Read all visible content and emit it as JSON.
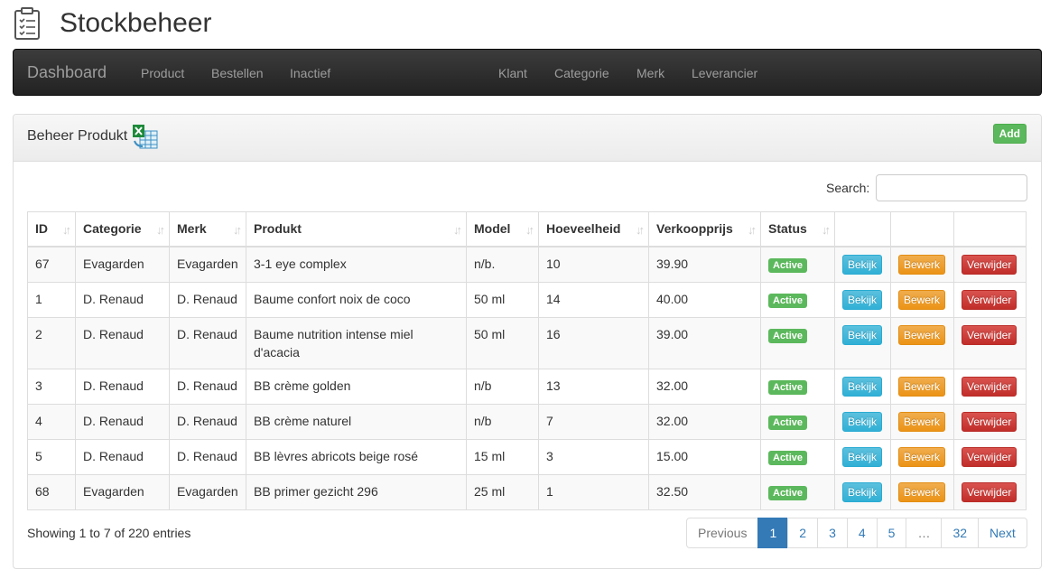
{
  "app": {
    "title": "Stockbeheer",
    "icon": "clipboard-icon"
  },
  "navbar": {
    "brand": "Dashboard",
    "links": [
      "Product",
      "Bestellen",
      "Inactief",
      "Klant",
      "Categorie",
      "Merk",
      "Leverancier"
    ]
  },
  "panel": {
    "title": "Beheer Produkt",
    "title_icon": "excel-icon",
    "add_label": "Add"
  },
  "search": {
    "label": "Search:",
    "value": ""
  },
  "table": {
    "headers": [
      "ID",
      "Categorie",
      "Merk",
      "Produkt",
      "Model",
      "Hoeveelheid",
      "Verkoopprijs",
      "Status",
      "",
      "",
      ""
    ],
    "rows": [
      {
        "id": "67",
        "categorie": "Evagarden",
        "merk": "Evagarden",
        "produkt": "3-1 eye complex",
        "model": "n/b.",
        "hoeveelheid": "10",
        "prijs": "39.90",
        "status": "Active"
      },
      {
        "id": "1",
        "categorie": "D. Renaud",
        "merk": "D. Renaud",
        "produkt": "Baume confort noix de coco",
        "model": "50 ml",
        "hoeveelheid": "14",
        "prijs": "40.00",
        "status": "Active"
      },
      {
        "id": "2",
        "categorie": "D. Renaud",
        "merk": "D. Renaud",
        "produkt": "Baume nutrition intense miel d'acacia",
        "model": "50 ml",
        "hoeveelheid": "16",
        "prijs": "39.00",
        "status": "Active"
      },
      {
        "id": "3",
        "categorie": "D. Renaud",
        "merk": "D. Renaud",
        "produkt": "BB crème golden",
        "model": "n/b",
        "hoeveelheid": "13",
        "prijs": "32.00",
        "status": "Active"
      },
      {
        "id": "4",
        "categorie": "D. Renaud",
        "merk": "D. Renaud",
        "produkt": "BB crème naturel",
        "model": "n/b",
        "hoeveelheid": "7",
        "prijs": "32.00",
        "status": "Active"
      },
      {
        "id": "5",
        "categorie": "D. Renaud",
        "merk": "D. Renaud",
        "produkt": "BB lèvres abricots beige rosé",
        "model": "15 ml",
        "hoeveelheid": "3",
        "prijs": "15.00",
        "status": "Active"
      },
      {
        "id": "68",
        "categorie": "Evagarden",
        "merk": "Evagarden",
        "produkt": "BB primer gezicht 296",
        "model": "25 ml",
        "hoeveelheid": "1",
        "prijs": "32.50",
        "status": "Active"
      }
    ],
    "actions": {
      "view": "Bekijk",
      "edit": "Bewerk",
      "delete": "Verwijder"
    }
  },
  "info": "Showing 1 to 7 of 220 entries",
  "pagination": {
    "previous": "Previous",
    "pages": [
      "1",
      "2",
      "3",
      "4",
      "5",
      "…",
      "32"
    ],
    "next": "Next",
    "current": "1"
  },
  "colors": {
    "navbar": "#222222",
    "success": "#5cb85c",
    "info": "#5bc0de",
    "warning": "#f0ad4e",
    "danger": "#d9534f",
    "primary": "#337ab7"
  }
}
